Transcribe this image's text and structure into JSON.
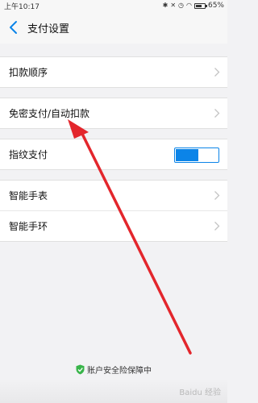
{
  "status_bar": {
    "time": "上午10:17",
    "battery": "65%",
    "battery_level": 0.65,
    "icons": [
      "bluetooth-icon",
      "mute-icon",
      "alarm-icon",
      "wifi-icon",
      "battery-icon"
    ]
  },
  "header": {
    "title": "支付设置",
    "back_icon": "chevron-left-icon"
  },
  "settings": {
    "group1": [
      {
        "label": "扣款顺序"
      }
    ],
    "group2": [
      {
        "label": "免密支付/自动扣款"
      }
    ],
    "group3": [
      {
        "label": "指纹支付",
        "toggle_on": true
      }
    ],
    "group4": [
      {
        "label": "智能手表"
      },
      {
        "label": "智能手环"
      }
    ]
  },
  "footer": {
    "text": "账户安全险保障中",
    "icon": "shield-check-icon"
  },
  "colors": {
    "accent": "#0b84e8",
    "shield": "#39b54a",
    "annotation_arrow": "#e3262c"
  },
  "watermark": {
    "text": "Baidu 经验"
  }
}
